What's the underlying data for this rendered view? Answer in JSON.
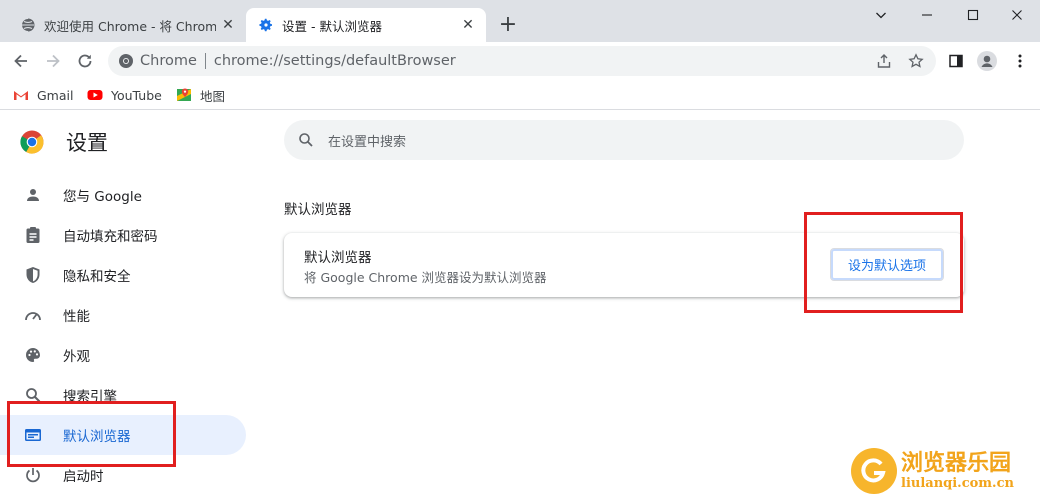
{
  "tabs": [
    {
      "title": "欢迎使用 Chrome - 将 Chrome",
      "active": false,
      "icon": "globe-icon"
    },
    {
      "title": "设置 - 默认浏览器",
      "active": true,
      "icon": "gear-icon"
    }
  ],
  "new_tab_label": "+",
  "window_controls": {
    "minimize": "minimize-icon",
    "maximize": "maximize-icon",
    "close": "close-icon",
    "tab_search": "chevron-down-icon"
  },
  "omnibox": {
    "site_label": "Chrome",
    "url": "chrome://settings/defaultBrowser"
  },
  "bookmarks": [
    {
      "label": "Gmail",
      "icon": "gmail-icon"
    },
    {
      "label": "YouTube",
      "icon": "youtube-icon"
    },
    {
      "label": "地图",
      "icon": "maps-icon"
    }
  ],
  "settings": {
    "title": "设置",
    "search_placeholder": "在设置中搜索",
    "nav": [
      {
        "label": "您与 Google",
        "icon": "person-icon",
        "selected": false
      },
      {
        "label": "自动填充和密码",
        "icon": "clipboard-icon",
        "selected": false
      },
      {
        "label": "隐私和安全",
        "icon": "shield-icon",
        "selected": false
      },
      {
        "label": "性能",
        "icon": "speedometer-icon",
        "selected": false
      },
      {
        "label": "外观",
        "icon": "palette-icon",
        "selected": false
      },
      {
        "label": "搜索引擎",
        "icon": "search-icon",
        "selected": false
      },
      {
        "label": "默认浏览器",
        "icon": "browser-icon",
        "selected": true
      },
      {
        "label": "启动时",
        "icon": "power-icon",
        "selected": false
      }
    ],
    "section_title": "默认浏览器",
    "card": {
      "heading": "默认浏览器",
      "description": "将 Google Chrome 浏览器设为默认浏览器",
      "button_label": "设为默认选项"
    }
  },
  "watermark": {
    "name": "浏览器乐园",
    "domain": "liulanqi.com.cn"
  },
  "colors": {
    "accent": "#1a73e8",
    "selected_bg": "#e8f0fe",
    "highlight_box": "#e11f1f",
    "tabstrip": "#dee1e6"
  }
}
